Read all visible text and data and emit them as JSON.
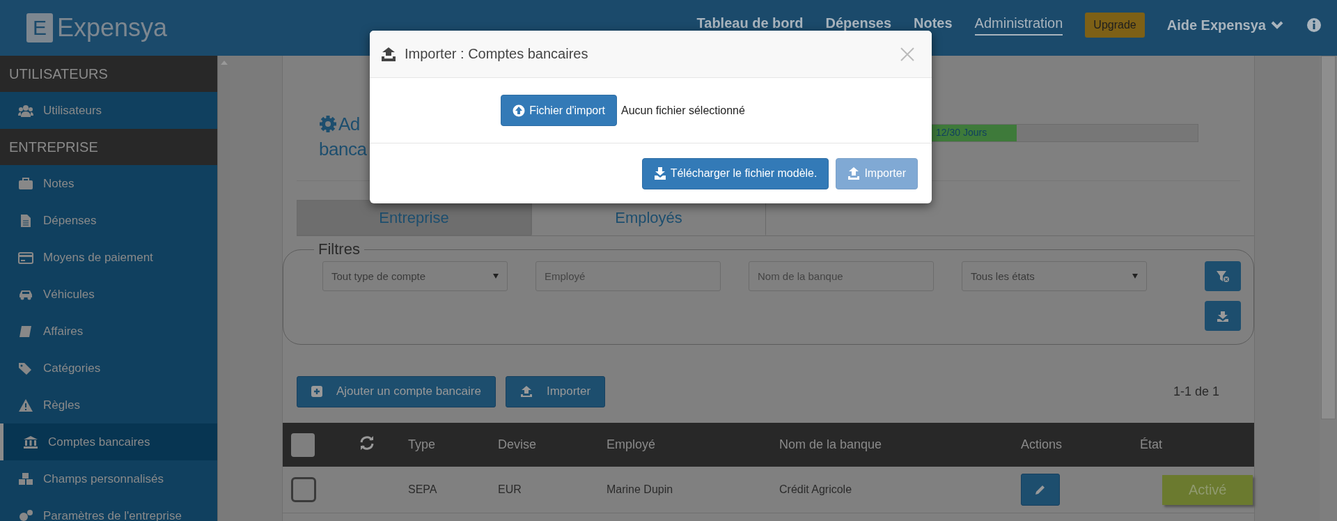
{
  "header": {
    "logo_letter": "E",
    "logo_text": "Expensya",
    "nav": [
      {
        "label": "Tableau de bord",
        "selected": false
      },
      {
        "label": "Dépenses",
        "selected": false
      },
      {
        "label": "Notes",
        "selected": false
      },
      {
        "label": "Administration",
        "selected": true
      }
    ],
    "upgrade": "Upgrade",
    "help": "Aide Expensya"
  },
  "sidebar": {
    "sections": [
      {
        "title": "UTILISATEURS",
        "items": [
          {
            "label": "Utilisateurs",
            "selected": false
          }
        ]
      },
      {
        "title": "ENTREPRISE",
        "items": [
          {
            "label": "Notes",
            "selected": false
          },
          {
            "label": "Dépenses",
            "selected": false
          },
          {
            "label": "Moyens de paiement",
            "selected": false
          },
          {
            "label": "Véhicules",
            "selected": false
          },
          {
            "label": "Affaires",
            "selected": false
          },
          {
            "label": "Catégories",
            "selected": false
          },
          {
            "label": "Règles",
            "selected": false
          },
          {
            "label": "Comptes bancaires",
            "selected": true
          },
          {
            "label": "Champs personnalisés",
            "selected": false
          },
          {
            "label": "Paramètres de l'entreprise",
            "selected": false
          }
        ]
      }
    ]
  },
  "page": {
    "title_lines": [
      "Ad",
      "banca"
    ],
    "trial": {
      "label": "12/30 Jours",
      "level": 0.32
    }
  },
  "tabs": [
    {
      "label": "Entreprise",
      "selected": false
    },
    {
      "label": "Employés",
      "selected": true
    }
  ],
  "filters": {
    "legend": "Filtres",
    "fields": [
      {
        "kind": "select",
        "value": "Tout type de compte"
      },
      {
        "kind": "input",
        "placeholder": "Employé"
      },
      {
        "kind": "input",
        "placeholder": "Nom de la banque"
      },
      {
        "kind": "select",
        "value": "Tous les états"
      }
    ]
  },
  "actions": [
    {
      "label": "Ajouter un compte bancaire",
      "kind": "add"
    },
    {
      "label": "Importer",
      "kind": "import"
    }
  ],
  "pagination": "1-1 de 1",
  "table": {
    "header_checked": false,
    "columns": [
      "Type",
      "Devise",
      "Employé",
      "Nom de la banque",
      "Actions",
      "État"
    ],
    "rows": [
      {
        "checked": false,
        "cells": [
          "SEPA",
          "EUR",
          "Marine Dupin",
          "Crédit Agricole"
        ],
        "status": "Activé"
      }
    ]
  },
  "modal": {
    "title": "Importer : Comptes bancaires",
    "file_button": "Fichier d'import",
    "file_status": "Aucun fichier sélectionné",
    "buttons": [
      {
        "label": "Télécharger le fichier modèle.",
        "kind": "download",
        "disabled": false
      },
      {
        "label": "Importer",
        "kind": "import",
        "disabled": true
      }
    ]
  }
}
